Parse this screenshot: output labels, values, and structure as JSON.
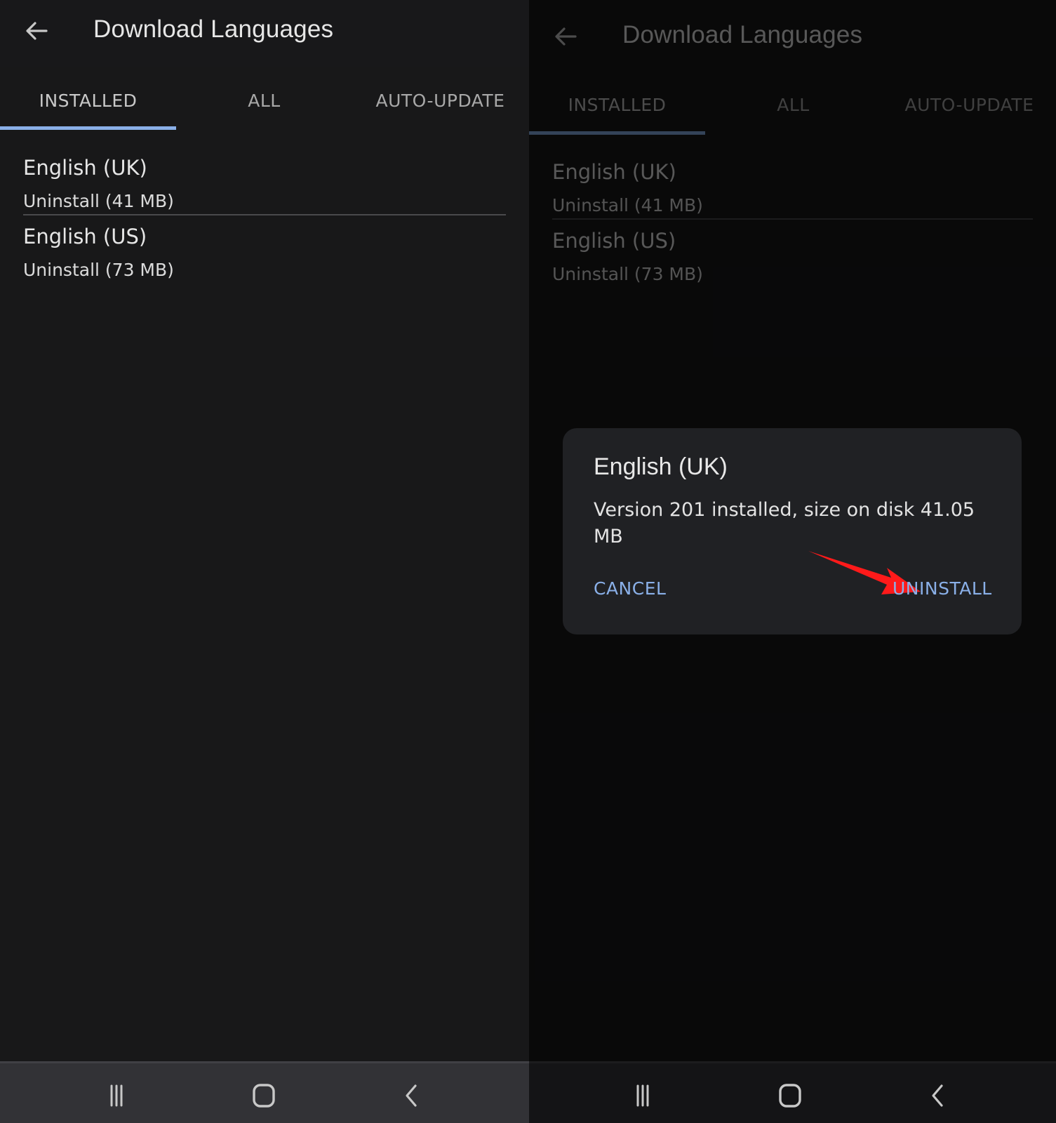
{
  "left_screen": {
    "app_bar": {
      "title": "Download Languages",
      "back_icon": "arrow-left-icon"
    },
    "tabs": [
      {
        "label": "INSTALLED",
        "active": true
      },
      {
        "label": "ALL",
        "active": false
      },
      {
        "label": "AUTO-UPDATE",
        "active": false
      }
    ],
    "languages": [
      {
        "name": "English (UK)",
        "action": "Uninstall (41 MB)"
      },
      {
        "name": "English (US)",
        "action": "Uninstall (73 MB)"
      }
    ],
    "nav_bar": [
      "recents-icon",
      "home-icon",
      "back-icon"
    ]
  },
  "right_screen": {
    "app_bar": {
      "title": "Download Languages",
      "back_icon": "arrow-left-icon"
    },
    "tabs": [
      {
        "label": "INSTALLED",
        "active": true
      },
      {
        "label": "ALL",
        "active": false
      },
      {
        "label": "AUTO-UPDATE",
        "active": false
      }
    ],
    "languages": [
      {
        "name": "English (UK)",
        "action": "Uninstall (41 MB)"
      },
      {
        "name": "English (US)",
        "action": "Uninstall (73 MB)"
      }
    ],
    "dialog": {
      "title": "English (UK)",
      "body": "Version 201 installed, size on disk 41.05 MB",
      "cancel_label": "CANCEL",
      "confirm_label": "UNINSTALL"
    },
    "annotation": {
      "type": "arrow",
      "points_to": "UNINSTALL",
      "color": "#ff1a1a"
    },
    "nav_bar": [
      "recents-icon",
      "home-icon",
      "back-icon"
    ]
  },
  "colors": {
    "accent": "#8ab0e8",
    "background": "#181819",
    "dialog_background": "#202124",
    "annotation": "#ff1a1a"
  }
}
